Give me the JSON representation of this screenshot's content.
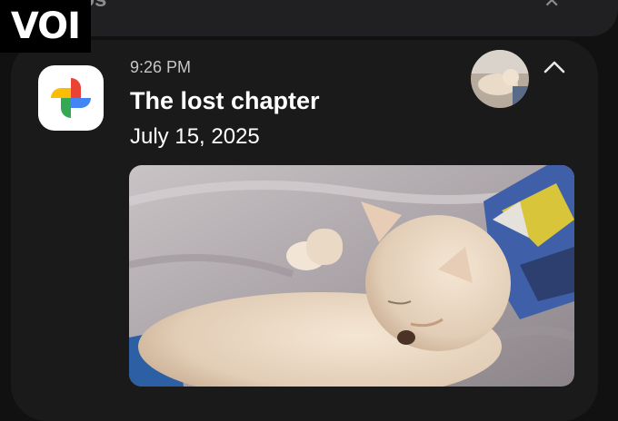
{
  "background_notification": {
    "title": "Photos",
    "close_icon": "close-icon"
  },
  "watermark": {
    "text": "VOI"
  },
  "notification": {
    "app_icon": "google-photos-icon",
    "time": "9:26 PM",
    "title": "The lost chapter",
    "date": "July 15, 2025",
    "thumbnail": "cat-thumbnail",
    "expand_icon": "chevron-up-icon",
    "image": "sleeping-cat-photo"
  },
  "colors": {
    "card": "#1a1a1b",
    "background": "#111112",
    "text_primary": "#ffffff",
    "text_secondary": "#c6c6c8",
    "photos_red": "#ea4335",
    "photos_yellow": "#fbbc04",
    "photos_green": "#34a853",
    "photos_blue": "#4285f4"
  }
}
